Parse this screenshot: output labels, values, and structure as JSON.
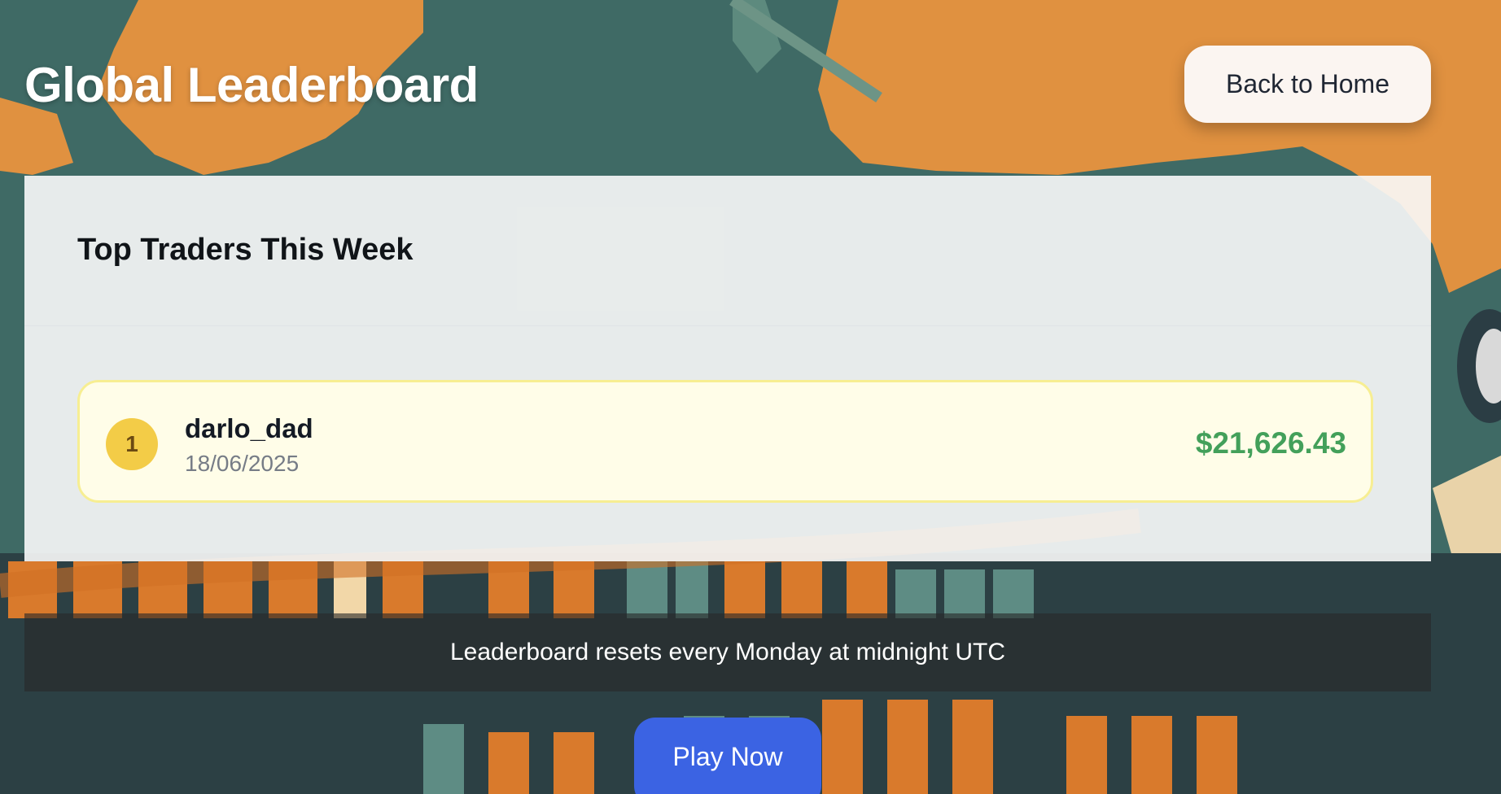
{
  "header": {
    "title": "Global Leaderboard",
    "back_label": "Back to Home"
  },
  "leaderboard": {
    "title": "Top Traders This Week",
    "entries": [
      {
        "rank": "1",
        "name": "darlo_dad",
        "date": "18/06/2025",
        "score": "$21,626.43"
      }
    ]
  },
  "notice": "Leaderboard resets every Monday at midnight UTC",
  "play_label": "Play Now",
  "colors": {
    "accent_button": "#3b63e3",
    "score_green": "#43a05a",
    "rank_gold": "#f3cc47",
    "entry_highlight": "#fffde8"
  }
}
